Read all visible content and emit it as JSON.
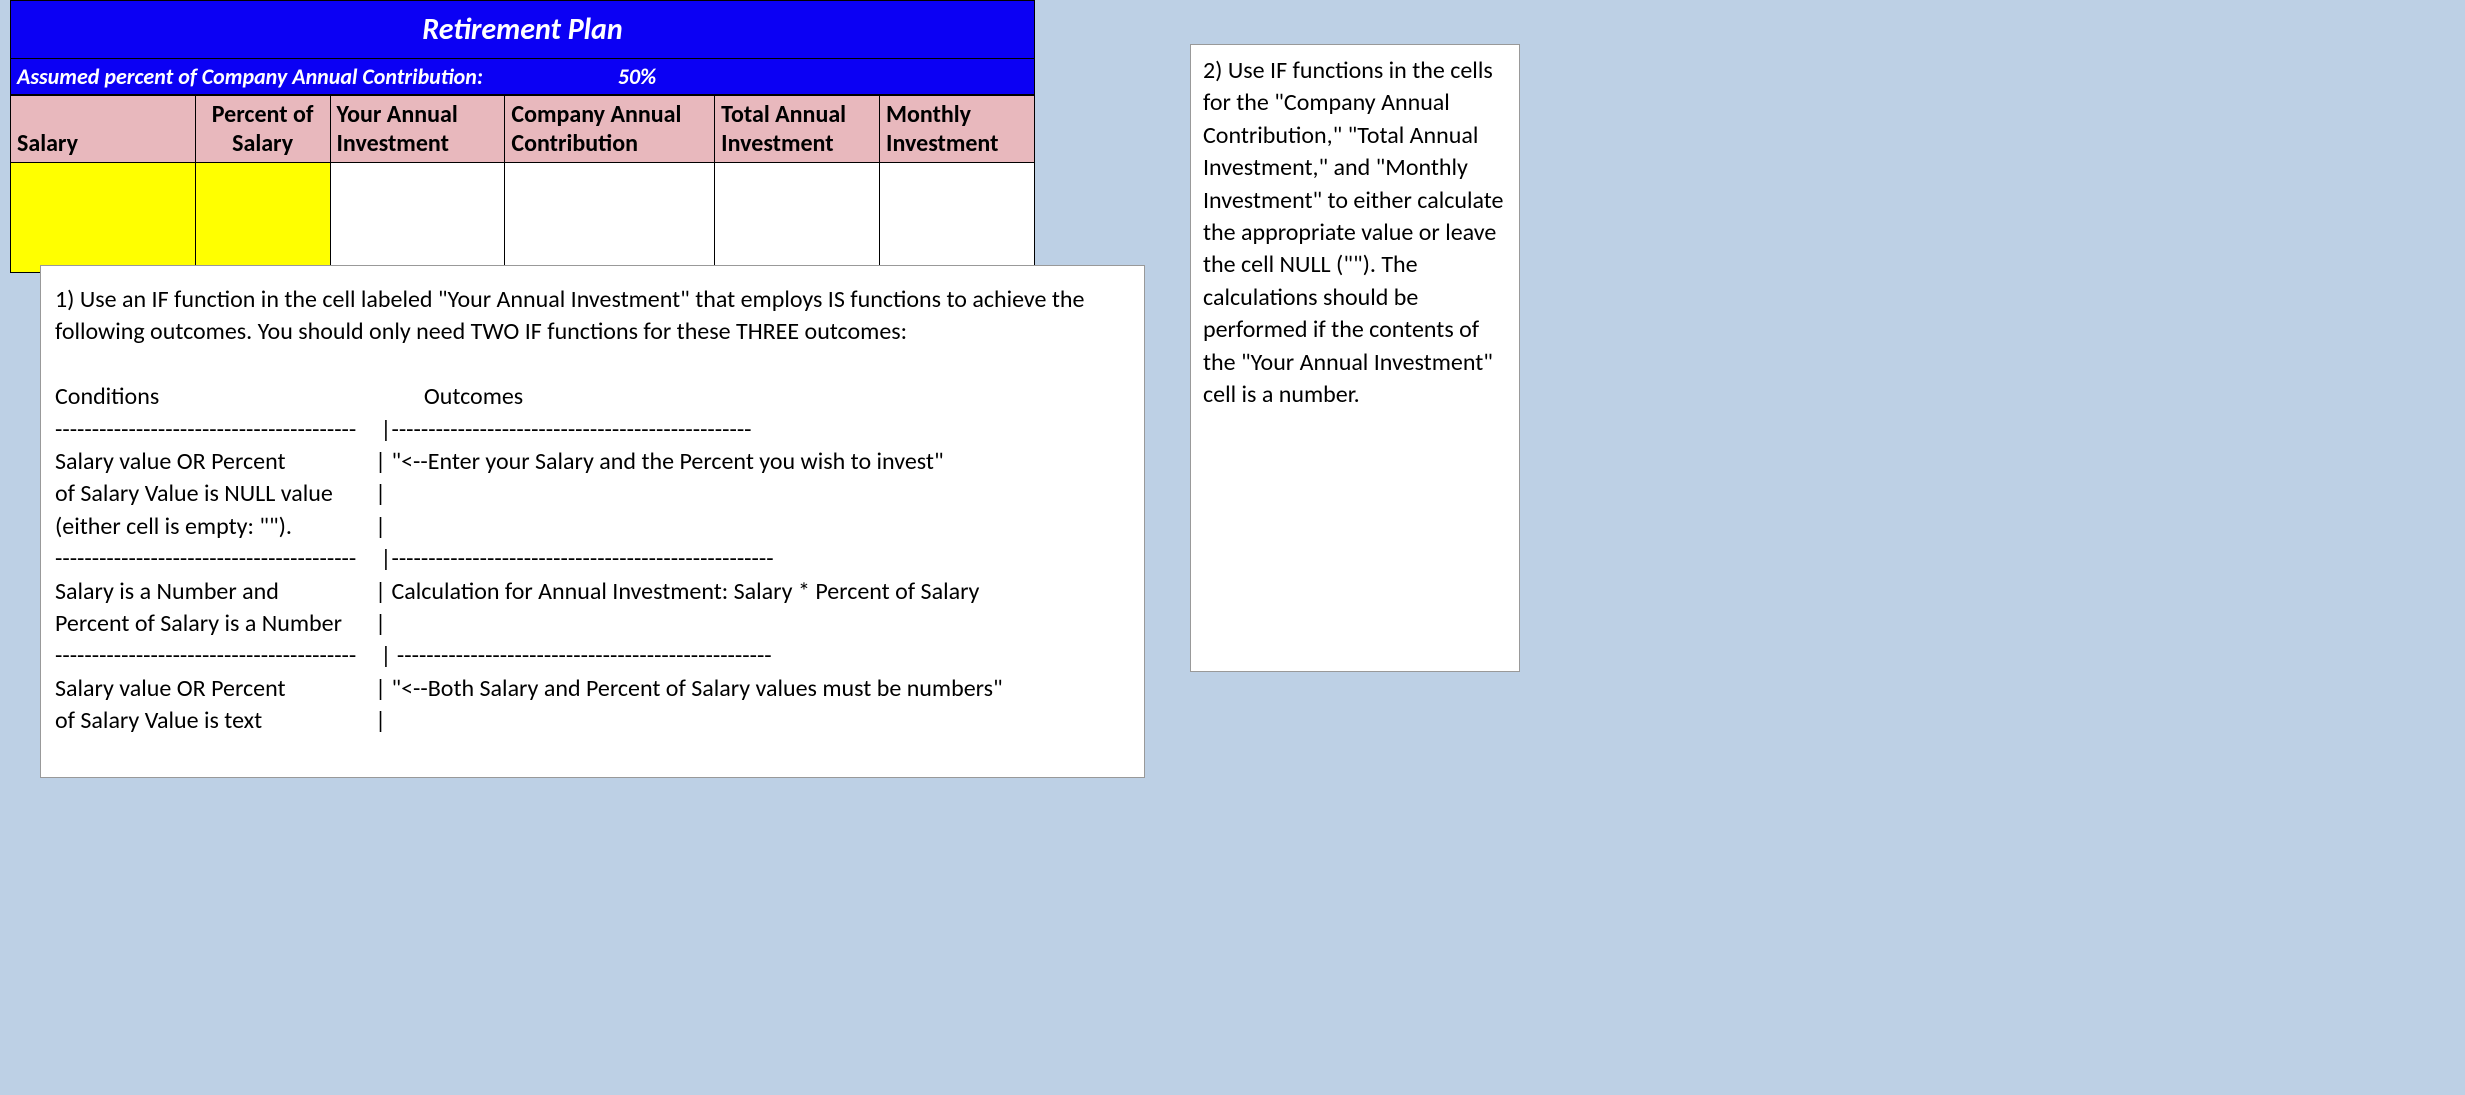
{
  "title": "Retirement Plan",
  "assumption": {
    "label": "Assumed percent of Company Annual Contribution:",
    "value": "50%"
  },
  "headers": {
    "salary": "Salary",
    "percent": "Percent of Salary",
    "yourAnnual": "Your Annual Investment",
    "companyAnnual": "Company Annual Contribution",
    "totalAnnual": "Total Annual Investment",
    "monthly": "Monthly Investment"
  },
  "cells": {
    "salary": "",
    "percent": "",
    "yourAnnual": "",
    "companyAnnual": "",
    "totalAnnual": "",
    "monthly": ""
  },
  "textbox1": {
    "intro": "1) Use an IF function in the cell labeled \"Your Annual Investment\" that employs IS functions to achieve the following outcomes. You should only need TWO IF functions for  these THREE outcomes:",
    "headCond": "Conditions",
    "headOut": "Outcomes",
    "divider1a": "-----------------------------------------",
    "divider1b": " |-------------------------------------------------",
    "r1c1": "Salary value OR Percent",
    "r1c2": "|  \"<--Enter your Salary and the Percent you wish to invest\"",
    "r1c3": "of Salary Value is NULL value",
    "r1c4": "|",
    "r1c5": "(either cell is empty: \"\").",
    "r1c6": "|",
    "divider2a": "-----------------------------------------",
    "divider2b": " |----------------------------------------------------",
    "r2c1": "Salary is a Number and",
    "r2c2": "|   Calculation for Annual Investment: Salary * Percent of Salary",
    "r2c3": "Percent of Salary is a Number",
    "r2c4": "|",
    "divider3a": "-----------------------------------------",
    "divider3b": " | ---------------------------------------------------",
    "r3c1": "Salary value OR Percent",
    "r3c2": "|  \"<--Both Salary and Percent of Salary values must be numbers\"",
    "r3c3": "of Salary Value is text",
    "r3c4": "|"
  },
  "textbox2": {
    "text": "2) Use IF functions in the cells for the \"Company Annual Contribution,\" \"Total Annual Investment,\" and \"Monthly Investment\" to either calculate the appropriate value or leave the cell NULL (\"\"). The calculations should be performed if the contents of the \"Your Annual Investment\" cell is a number."
  }
}
